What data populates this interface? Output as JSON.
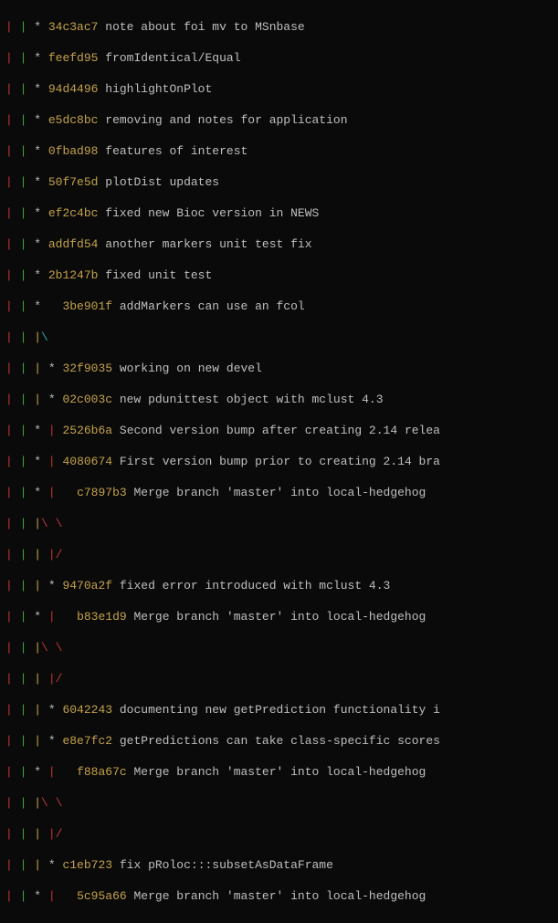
{
  "commits": [
    {
      "hash": "34c3ac7",
      "message": "note about foi mv to MSnbase"
    },
    {
      "hash": "feefd95",
      "message": "fromIdentical/Equal"
    },
    {
      "hash": "94d4496",
      "message": "highlightOnPlot"
    },
    {
      "hash": "e5dc8bc",
      "message": "removing and notes for application"
    },
    {
      "hash": "0fbad98",
      "message": "features of interest"
    },
    {
      "hash": "50f7e5d",
      "message": "plotDist updates"
    },
    {
      "hash": "ef2c4bc",
      "message": "fixed new Bioc version in NEWS"
    },
    {
      "hash": "addfd54",
      "message": "another markers unit test fix"
    },
    {
      "hash": "2b1247b",
      "message": "fixed unit test"
    },
    {
      "hash": "3be901f",
      "message": "addMarkers can use an fcol"
    },
    {
      "hash": "32f9035",
      "message": "working on new devel"
    },
    {
      "hash": "02c003c",
      "message": "new pdunittest object with mclust 4.3"
    },
    {
      "hash": "2526b6a",
      "message": "Second version bump after creating 2.14 relea"
    },
    {
      "hash": "4080674",
      "message": "First version bump prior to creating 2.14 bra"
    },
    {
      "hash": "c7897b3",
      "message": "Merge branch 'master' into local-hedgehog"
    },
    {
      "hash": "9470a2f",
      "message": "fixed error introduced with mclust 4.3"
    },
    {
      "hash": "b83e1d9",
      "message": "Merge branch 'master' into local-hedgehog"
    },
    {
      "hash": "6042243",
      "message": "documenting new getPrediction functionality i"
    },
    {
      "hash": "e8e7fc2",
      "message": "getPredictions can take class-specific scores"
    },
    {
      "hash": "f88a67c",
      "message": "Merge branch 'master' into local-hedgehog"
    },
    {
      "hash": "c1eb723",
      "message": "fix pRoloc:::subsetAsDataFrame"
    },
    {
      "hash": "5c95a66",
      "message": "Merge branch 'master' into local-hedgehog"
    }
  ]
}
